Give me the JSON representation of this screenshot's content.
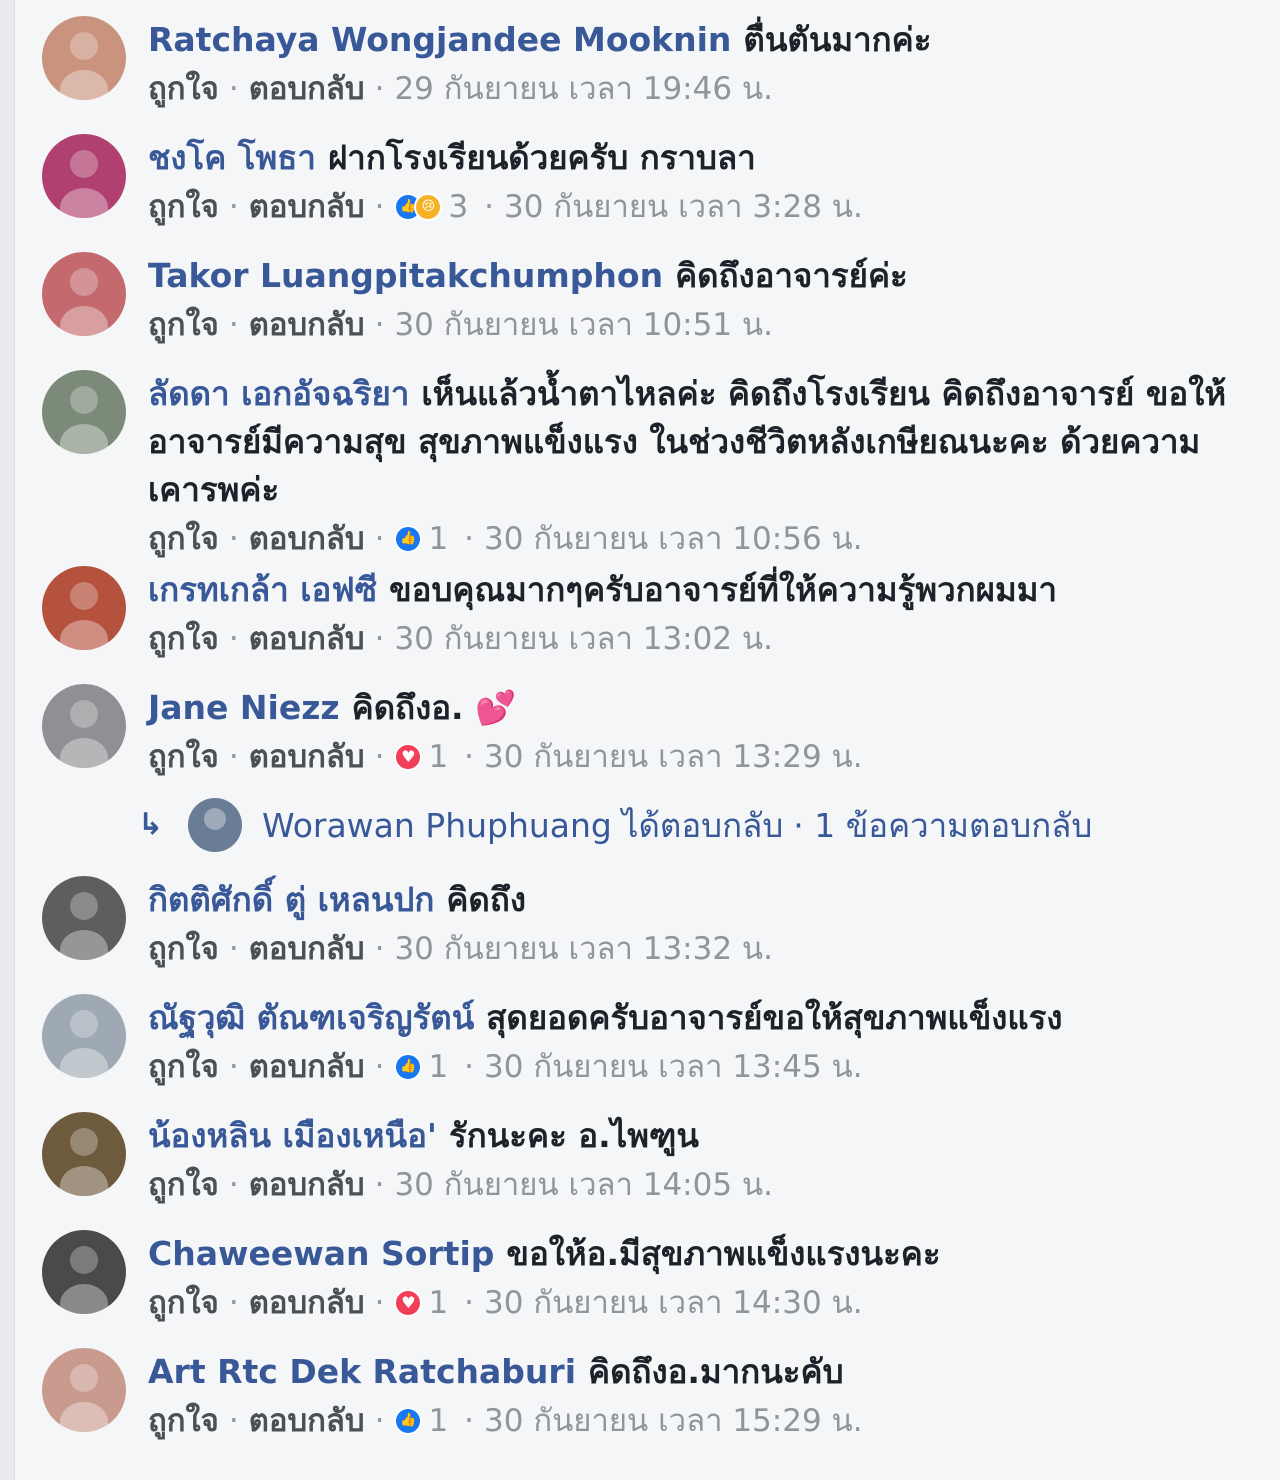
{
  "ui": {
    "like_label": "ถูกใจ",
    "reply_label": "ตอบกลับ",
    "separator": "·"
  },
  "colors": {
    "author_link": "#385898",
    "meta_text": "#90949c",
    "like_blue": "#1877f2",
    "love_red": "#f33e58"
  },
  "comments": [
    {
      "author": "Ratchaya Wongjandee Mooknin",
      "text": "ตื่นตันมากค่ะ",
      "timestamp": "29 กันยายน เวลา 19:46 น.",
      "avatar_color": "#c9937e"
    },
    {
      "author": "ชงโค โพธา",
      "text": "ฝากโรงเรียนด้วยครับ กราบลา",
      "reactions": [
        "like-icon",
        "sad-icon"
      ],
      "reaction_count": "3",
      "timestamp": "30 กันยายน เวลา 3:28 น.",
      "avatar_color": "#b0406f"
    },
    {
      "author": "Takor Luangpitakchumphon",
      "text": "คิดถึงอาจารย์ค่ะ",
      "timestamp": "30 กันยายน เวลา 10:51 น.",
      "avatar_color": "#c46a6e"
    },
    {
      "author": "ลัดดา เอกอัจฉริยา",
      "text": "เห็นแล้วน้ำตาไหลค่ะ คิดถึงโรงเรียน คิดถึงอาจารย์ ขอให้อาจารย์มีความสุข สุขภาพแข็งแรง ในช่วงชีวิตหลังเกษียณนะคะ ด้วยความเคารพค่ะ",
      "reactions": [
        "like-icon"
      ],
      "reaction_count": "1",
      "timestamp": "30 กันยายน เวลา 10:56 น.",
      "avatar_color": "#7c8a7a"
    },
    {
      "author": "เกรทเกล้า เอฟซี",
      "text": "ขอบคุณมากๆครับอาจารย์ที่ให้ความรู้พวกผมมา",
      "timestamp": "30 กันยายน เวลา 13:02 น.",
      "avatar_color": "#b5523e"
    },
    {
      "author": "Jane Niezz",
      "text": "คิดถึงอ. 💕",
      "reactions": [
        "love-icon"
      ],
      "reaction_count": "1",
      "timestamp": "30 กันยายน เวลา 13:29 น.",
      "avatar_color": "#8f9094",
      "reply_summary": {
        "name": "Worawan Phuphuang",
        "action": "ได้ตอบกลับ",
        "count": "· 1 ข้อความตอบกลับ"
      }
    },
    {
      "author": "กิตติศักดิ์ ตู่ เหลนปก",
      "text": "คิดถึง",
      "timestamp": "30 กันยายน เวลา 13:32 น.",
      "avatar_color": "#5e5e5e"
    },
    {
      "author": "ณัฐวุฒิ ตัณฑเจริญรัตน์",
      "text": "สุดยอดครับอาจารย์ขอให้สุขภาพแข็งแรง",
      "reactions": [
        "like-icon"
      ],
      "reaction_count": "1",
      "timestamp": "30 กันยายน เวลา 13:45 น.",
      "avatar_color": "#9fa9b3"
    },
    {
      "author": "น้องหลิน เมืองเหนือ'",
      "text": "รักนะคะ อ.ไพฑูน",
      "timestamp": "30 กันยายน เวลา 14:05 น.",
      "avatar_color": "#6e5a3d"
    },
    {
      "author": "Chaweewan Sortip",
      "text": "ขอให้อ.มีสุขภาพแข็งแรงนะคะ",
      "reactions": [
        "love-icon"
      ],
      "reaction_count": "1",
      "timestamp": "30 กันยายน เวลา 14:30 น.",
      "avatar_color": "#4a4a4a"
    },
    {
      "author": "Art Rtc Dek Ratchaburi",
      "text": "คิดถึงอ.มากนะคับ",
      "reactions": [
        "like-icon"
      ],
      "reaction_count": "1",
      "timestamp": "30 กันยายน เวลา 15:29 น.",
      "avatar_color": "#c99b8f"
    }
  ]
}
